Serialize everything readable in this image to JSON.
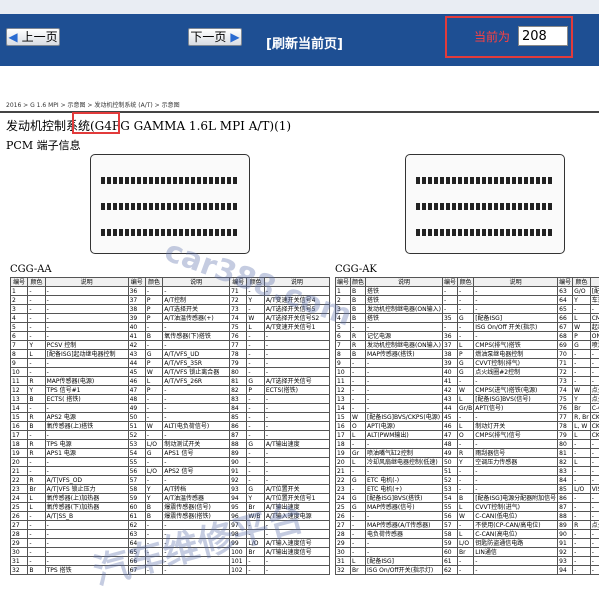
{
  "toolbar": {
    "prev_label": "上一页",
    "next_label": "下一页",
    "refresh_label": "[刷新当前页]",
    "current_label": "当前为",
    "current_page": "208"
  },
  "document": {
    "breadcrumb": "2016 > G 1.6 MPI > 示意图 > 发动机控制系统 (A/T) > 示意图",
    "title": "发动机控制系统(G4FG GAMMA 1.6L MPI A/T)(1)",
    "section": "PCM 端子信息",
    "table_a_label": "CGG-AA",
    "table_k_label": "CGG-AK",
    "watermark_1": "car388.com",
    "watermark_2": "汽车维修平台"
  },
  "table_headers": [
    "编号",
    "颜色",
    "说明",
    "编号",
    "颜色",
    "说明",
    "编号",
    "颜色",
    "说明"
  ],
  "table_a_rows": [
    [
      "1",
      "-",
      "-",
      "36",
      "-",
      "-",
      "71",
      "-",
      "-"
    ],
    [
      "2",
      "-",
      "-",
      "37",
      "P",
      "A/T控制",
      "72",
      "Y",
      "A/T变速开关信号4"
    ],
    [
      "3",
      "-",
      "-",
      "38",
      "P",
      "A/T选择开关",
      "73",
      "-",
      "A/T选择开关信号5"
    ],
    [
      "4",
      "-",
      "-",
      "39",
      "P",
      "A/T油温传感器(+)",
      "74",
      "W",
      "A/T选择开关信号S2"
    ],
    [
      "5",
      "-",
      "-",
      "40",
      "-",
      "-",
      "75",
      "L",
      "A/T变速开关信号1"
    ],
    [
      "6",
      "-",
      "-",
      "41",
      "B",
      "氧传感器(下)搭铁",
      "76",
      "-",
      "-"
    ],
    [
      "7",
      "Y",
      "PCSV 控制",
      "42",
      "-",
      "-",
      "77",
      "-",
      "-"
    ],
    [
      "8",
      "L",
      "[配备ISG]起动继电器控制",
      "43",
      "G",
      "A/T/VFS_UD",
      "78",
      "-",
      "-"
    ],
    [
      "9",
      "-",
      "-",
      "44",
      "P",
      "A/T/VFS_35R",
      "79",
      "-",
      "-"
    ],
    [
      "10",
      "-",
      "-",
      "45",
      "W",
      "A/T/VFS 锁止离合器",
      "80",
      "-",
      "-"
    ],
    [
      "11",
      "R",
      "MAP传感器(电源)",
      "46",
      "L",
      "A/T/VFS_26R",
      "81",
      "G",
      "A/T选择开关信号"
    ],
    [
      "12",
      "Y",
      "TPS 信号#1",
      "47",
      "P",
      "-",
      "82",
      "P",
      "ECTS(搭铁)"
    ],
    [
      "13",
      "B",
      "ECTS( 搭铁)",
      "48",
      "-",
      "-",
      "83",
      "-",
      "-"
    ],
    [
      "14",
      "-",
      "-",
      "49",
      "-",
      "-",
      "84",
      "-",
      "-"
    ],
    [
      "15",
      "R",
      "APS2 电源",
      "50",
      "-",
      "-",
      "85",
      "-",
      "-"
    ],
    [
      "16",
      "B",
      "氧传感器(上)搭铁",
      "51",
      "W",
      "ALT(电负荷信号)",
      "86",
      "-",
      "-"
    ],
    [
      "17",
      "-",
      "-",
      "52",
      "-",
      "-",
      "87",
      "-",
      "-"
    ],
    [
      "18",
      "R",
      "TPS 电源",
      "53",
      "L/O",
      "制动测试开关",
      "88",
      "G",
      "A/T输出速度"
    ],
    [
      "19",
      "R",
      "APS1 电源",
      "54",
      "G",
      "APS1 信号",
      "89",
      "-",
      "-"
    ],
    [
      "20",
      "-",
      "-",
      "55",
      "-",
      "-",
      "90",
      "-",
      "-"
    ],
    [
      "21",
      "-",
      "-",
      "56",
      "L/O",
      "APS2 信号",
      "91",
      "-",
      "-"
    ],
    [
      "22",
      "R",
      "A/T|VFS_OD",
      "57",
      "-",
      "-",
      "92",
      "-",
      "-"
    ],
    [
      "23",
      "Br",
      "A/T|VFS 锁止压力",
      "58",
      "Y",
      "A/T转档",
      "93",
      "G",
      "A/T位置开关"
    ],
    [
      "24",
      "L",
      "氧传感器(上)加热器",
      "59",
      "Y",
      "A/T油温传感器",
      "94",
      "Y",
      "A/T位置开关信号1"
    ],
    [
      "25",
      "L",
      "氧传感器(下)加热器",
      "60",
      "B",
      "爆震传感器(信号)",
      "95",
      "Br",
      "A/T输出速度"
    ],
    [
      "26",
      "-",
      "A/T|SS_B",
      "61",
      "B",
      "爆震传感器(搭铁)",
      "96",
      "W/B",
      "A/T输入速度电源"
    ],
    [
      "27",
      "-",
      "-",
      "62",
      "-",
      "-",
      "97",
      "-",
      "-"
    ],
    [
      "28",
      "-",
      "-",
      "63",
      "-",
      "-",
      "98",
      "-",
      "-"
    ],
    [
      "29",
      "-",
      "-",
      "64",
      "-",
      "-",
      "99",
      "L/O",
      "A/T输入速度信号"
    ],
    [
      "30",
      "-",
      "-",
      "65",
      "-",
      "-",
      "100",
      "Br",
      "A/T输出速度信号"
    ],
    [
      "31",
      "-",
      "-",
      "66",
      "-",
      "-",
      "101",
      "-",
      "-"
    ],
    [
      "32",
      "B",
      "TPS 搭铁",
      "67",
      "-",
      "-",
      "102",
      "-",
      "-"
    ]
  ],
  "table_k_rows": [
    [
      "1",
      "B",
      "搭铁",
      "-",
      "-",
      "-",
      "63",
      "G/O",
      "[配备ISG]"
    ],
    [
      "2",
      "B",
      "搭铁",
      "-",
      "-",
      "-",
      "64",
      "Y",
      "车速输入"
    ],
    [
      "3",
      "B",
      "发动机控制继电器(ON输入)",
      "-",
      "-",
      "-",
      "65",
      "-",
      "-"
    ],
    [
      "4",
      "B",
      "搭铁",
      "35",
      "G",
      "[配备ISG]",
      "66",
      "L",
      "CMPS(排气)"
    ],
    [
      "5",
      "-",
      "-",
      "-",
      "-",
      "ISG On/Off 开关(指示)",
      "67",
      "W",
      "起动开关"
    ],
    [
      "6",
      "R",
      "记忆电源",
      "36",
      "-",
      "-",
      "68",
      "P",
      "ON/START"
    ],
    [
      "7",
      "R",
      "发动机控制继电器(ON输入)",
      "37",
      "L",
      "CMPS(排气)搭铁",
      "69",
      "G",
      "喷油嘴"
    ],
    [
      "8",
      "B",
      "MAP传感器(搭铁)",
      "38",
      "P",
      "燃油泵继电器控制",
      "70",
      "-",
      "-"
    ],
    [
      "9",
      "-",
      "-",
      "39",
      "G",
      "CVVT控制(排气)",
      "71",
      "-",
      "-"
    ],
    [
      "10",
      "-",
      "-",
      "40",
      "G",
      "点火线圈#2控制",
      "72",
      "-",
      "-"
    ],
    [
      "11",
      "-",
      "-",
      "41",
      "-",
      "-",
      "73",
      "-",
      "-"
    ],
    [
      "12",
      "-",
      "-",
      "42",
      "W",
      "CMPS(进气)搭铁(电源)",
      "74",
      "W",
      "点火线圈"
    ],
    [
      "13",
      "-",
      "-",
      "43",
      "L",
      "[配备ISG]BVS(信号)",
      "75",
      "Y",
      "点火线圈"
    ],
    [
      "14",
      "-",
      "-",
      "44",
      "Gr/B",
      "APT(信号)",
      "76",
      "Br",
      "C-CAN"
    ],
    [
      "15",
      "W",
      "[配备ISG]BVS/CKPS(电源)",
      "45",
      "-",
      "-",
      "77",
      "R, Br",
      "CKPS(信号)"
    ],
    [
      "16",
      "O",
      "APT(电源)",
      "46",
      "L",
      "制动灯开关",
      "78",
      "L, W",
      "CKPS(信号)"
    ],
    [
      "17",
      "L",
      "ALT(PWM输出)",
      "47",
      "O",
      "CMPS(排气)信号",
      "79",
      "L",
      "CKPS"
    ],
    [
      "18",
      "-",
      "-",
      "48",
      "-",
      "-",
      "80",
      "-",
      "-"
    ],
    [
      "19",
      "Gr",
      "喷油嘴气缸2控制",
      "49",
      "R",
      "雨刮器信号",
      "81",
      "-",
      "-"
    ],
    [
      "20",
      "L",
      "冷却风扇继电器控制(低速)",
      "50",
      "Y",
      "空调压力传感器",
      "82",
      "L",
      "-"
    ],
    [
      "21",
      "-",
      "-",
      "51",
      "-",
      "-",
      "83",
      "-",
      "-"
    ],
    [
      "22",
      "G",
      "ETC 电机(-)",
      "52",
      "-",
      "-",
      "84",
      "-",
      "-"
    ],
    [
      "23",
      "-",
      "ETC 电机(+)",
      "53",
      "-",
      "-",
      "85",
      "L/O",
      "VIS控制"
    ],
    [
      "24",
      "G",
      "[配备ISG]BVS(搭铁)",
      "54",
      "B",
      "[配备ISG]电源分配器附加信号",
      "86",
      "-",
      "-"
    ],
    [
      "25",
      "G",
      "MAP传感器(信号)",
      "55",
      "L",
      "CVVT控制(进气)",
      "87",
      "-",
      "-"
    ],
    [
      "26",
      "-",
      "-",
      "56",
      "W",
      "C-CAN(低电位)",
      "88",
      "-",
      "-"
    ],
    [
      "27",
      "-",
      "MAP传感器(A/T传感器)",
      "57",
      "-",
      "不使用(CP-CAN/高电位)",
      "89",
      "R",
      "点火线圈"
    ],
    [
      "28",
      "-",
      "电负荷传感器",
      "58",
      "L",
      "C-CAN(高电位)",
      "90",
      "-",
      "-"
    ],
    [
      "29",
      "-",
      "-",
      "59",
      "L/O",
      "钥匙防盗通信电路",
      "91",
      "-",
      "-"
    ],
    [
      "30",
      "-",
      "-",
      "60",
      "Br",
      "LIN通信",
      "92",
      "-",
      "-"
    ],
    [
      "31",
      "L",
      "[配备ISG]",
      "61",
      "-",
      "-",
      "93",
      "-",
      "-"
    ],
    [
      "32",
      "Br",
      "ISG On/Off开关(指示灯)",
      "62",
      "-",
      "-",
      "94",
      "-",
      "-"
    ]
  ]
}
